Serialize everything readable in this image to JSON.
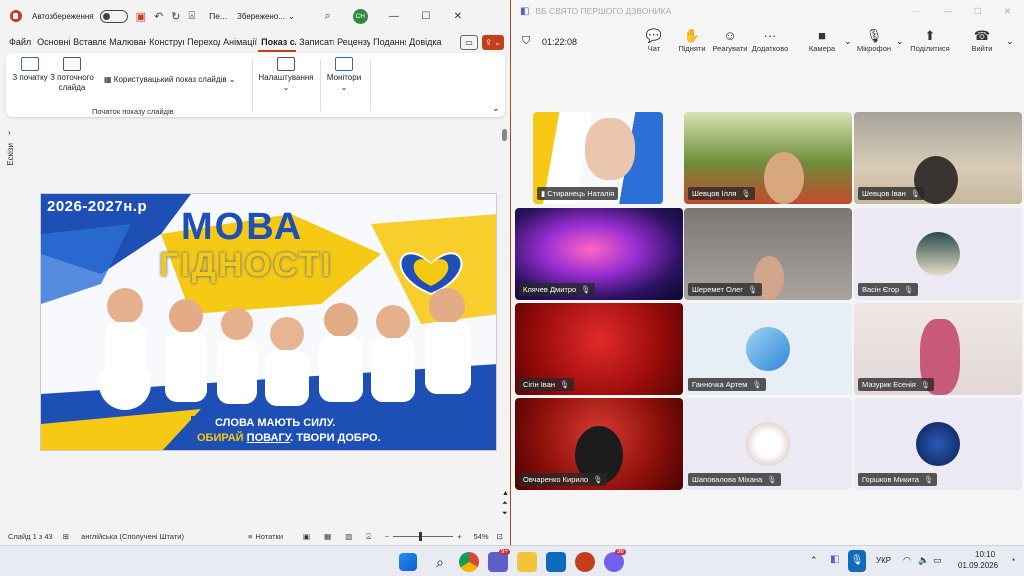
{
  "ppt": {
    "autosave": "Автозбереження",
    "doc_title": "Пе...",
    "saved": "Збережено...",
    "avatar": "СН",
    "tabs": [
      "Файл",
      "Основні",
      "Вставлення",
      "Малювання",
      "Конструктор",
      "Переходи",
      "Анімації",
      "Показ слайдів",
      "Записати",
      "Рецензування",
      "Подання",
      "Довідка"
    ],
    "ribbon": {
      "from_start": "З початку",
      "from_current": "З поточного слайда",
      "custom_show": "Користувацький показ слайдів",
      "group_start": "Початок показу слайдів",
      "setup": "Налаштування",
      "monitors": "Монітори"
    },
    "thumbs_label": "Ескізи",
    "slide": {
      "year": "2026-2027н.р",
      "title1": "МОВА",
      "title2": "ГІДНОСТІ",
      "slogan1": "СЛОВА МАЮТЬ СИЛУ.",
      "slogan2a": "ОБИРАЙ ",
      "slogan2b": "ПОВАГУ",
      "slogan2c": ". ТВОРИ ДОБРО."
    },
    "status": {
      "slide": "Слайд 1 з 43",
      "lang": "англійська (Сполучені Штати)",
      "notes": "Нотатки",
      "zoom": "54%"
    }
  },
  "teams": {
    "title": "ВБ СВЯТО ПЕРШОГО ДЗВОНИКА",
    "timer": "01:22:08",
    "toolbar": {
      "chat": "Чат",
      "raise": "Підняти",
      "react": "Реагувати",
      "more": "Додатково",
      "camera": "Камера",
      "mic": "Мікрофон",
      "share": "Поділитися",
      "leave": "Вийти"
    },
    "participants": [
      "Стиранець Наталія",
      "Шевцов Ілля",
      "Шевцов Іван",
      "Клячев Дмитро",
      "Шеремет Олег",
      "Васін Єгор",
      "Сігін Іван",
      "Ганночка Артем",
      "Мазурик Есенія",
      "Овчаренко Кирило",
      "Шаповалова Міхана",
      "Горшков Микита"
    ]
  },
  "taskbar": {
    "lang": "УКР",
    "time": "10:10",
    "date": "01.09.2026",
    "badge1": "9+",
    "badge2": "36"
  },
  "colors": {
    "ppt_accent": "#c43e1c",
    "teams_accent": "#5b5fc7"
  }
}
